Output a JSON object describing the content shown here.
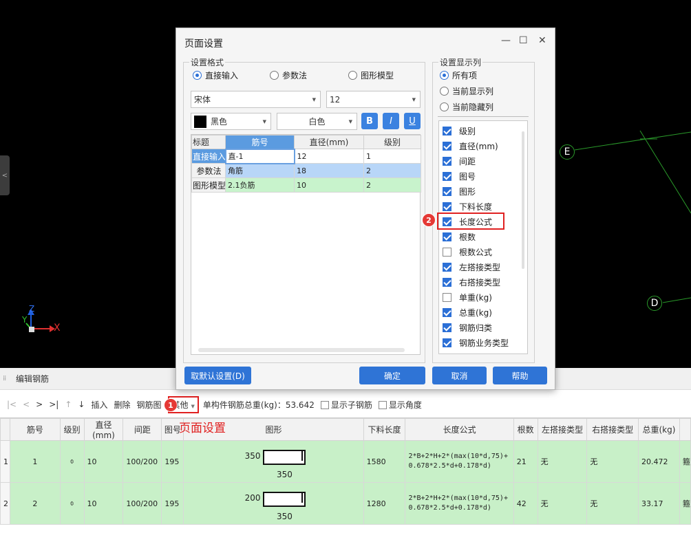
{
  "viewport": {
    "axis_z": "Z",
    "axis_y": "Y",
    "axis_x": "X",
    "grid_e": "E",
    "grid_d": "D",
    "side_tab": "<"
  },
  "panel": {
    "title": "编辑钢筋"
  },
  "toolbar": {
    "first": "|<",
    "prev": "<",
    "next": ">",
    "last": ">|",
    "up": "↑",
    "down": "↓",
    "insert": "插入",
    "delete": "删除",
    "library": "钢筋图",
    "other": "其他",
    "total_weight": "单构件钢筋总重(kg)：53.642",
    "show_sub": "显示子钢筋",
    "show_angle": "显示角度"
  },
  "annotations": {
    "badge1": "1",
    "badge2": "2",
    "callout": "页面设置"
  },
  "grid": {
    "headers": [
      "",
      "筋号",
      "级别",
      "直径(mm)",
      "间距",
      "图号",
      "图形",
      "下料长度",
      "长度公式",
      "根数",
      "左搭接类型",
      "右搭接类型",
      "总重(kg)",
      ""
    ],
    "rows": [
      {
        "num": "1",
        "jin_hao": "1",
        "grade": "⌽",
        "diameter": "10",
        "spacing": "100/200",
        "fig_no": "195",
        "shape_h": "350",
        "shape_w": "350",
        "cut_length": "1580",
        "formula": "2*B+2*H+2*(max(10*d,75)+0.678*2.5*d+0.178*d)",
        "count": "21",
        "left_lap": "无",
        "right_lap": "无",
        "total_weight": "20.472",
        "extra": "箍"
      },
      {
        "num": "2",
        "jin_hao": "2",
        "grade": "⌽",
        "diameter": "10",
        "spacing": "100/200",
        "fig_no": "195",
        "shape_h": "200",
        "shape_w": "350",
        "cut_length": "1280",
        "formula": "2*B+2*H+2*(max(10*d,75)+0.678*2.5*d+0.178*d)",
        "count": "42",
        "left_lap": "无",
        "right_lap": "无",
        "total_weight": "33.17",
        "extra": "箍"
      }
    ]
  },
  "dialog": {
    "title": "页面设置",
    "minimize": "—",
    "maximize": "☐",
    "close": "✕",
    "format_group": "设置格式",
    "radio_direct": "直接输入",
    "radio_param": "参数法",
    "radio_model": "图形模型",
    "font_name": "宋体",
    "font_size": "12",
    "fg_color_label": "黑色",
    "fg_color": "#000000",
    "bg_color_label": "白色",
    "bold": "B",
    "italic": "I",
    "underline": "U",
    "preview_headers": [
      "标题",
      "筋号",
      "直径(mm)",
      "级别"
    ],
    "preview_rows": [
      {
        "head": "直接输入",
        "a": "直-1",
        "b": "12",
        "c": "1"
      },
      {
        "head": "参数法",
        "a": "角筋",
        "b": "18",
        "c": "2"
      },
      {
        "head": "图形模型",
        "a": "2.1负筋",
        "b": "10",
        "c": "2"
      }
    ],
    "cols_group": "设置显示列",
    "radio_all": "所有项",
    "radio_shown": "当前显示列",
    "radio_hidden": "当前隐藏列",
    "columns": [
      {
        "label": "级别",
        "checked": true
      },
      {
        "label": "直径(mm)",
        "checked": true
      },
      {
        "label": "间距",
        "checked": true
      },
      {
        "label": "图号",
        "checked": true
      },
      {
        "label": "图形",
        "checked": true
      },
      {
        "label": "下料长度",
        "checked": true
      },
      {
        "label": "长度公式",
        "checked": true
      },
      {
        "label": "根数",
        "checked": true
      },
      {
        "label": "根数公式",
        "checked": false
      },
      {
        "label": "左搭接类型",
        "checked": true
      },
      {
        "label": "右搭接类型",
        "checked": true
      },
      {
        "label": "单重(kg)",
        "checked": false
      },
      {
        "label": "总重(kg)",
        "checked": true
      },
      {
        "label": "钢筋归类",
        "checked": true
      },
      {
        "label": "钢筋业务类型",
        "checked": true
      }
    ],
    "btn_default": "取默认设置(D)",
    "btn_ok": "确定",
    "btn_cancel": "取消",
    "btn_help": "帮助"
  },
  "colors": {
    "accent": "#2f74d6",
    "highlight_red": "#e02020",
    "row_green": "#c8f0c8",
    "grid_line": "#2a9a2a"
  }
}
